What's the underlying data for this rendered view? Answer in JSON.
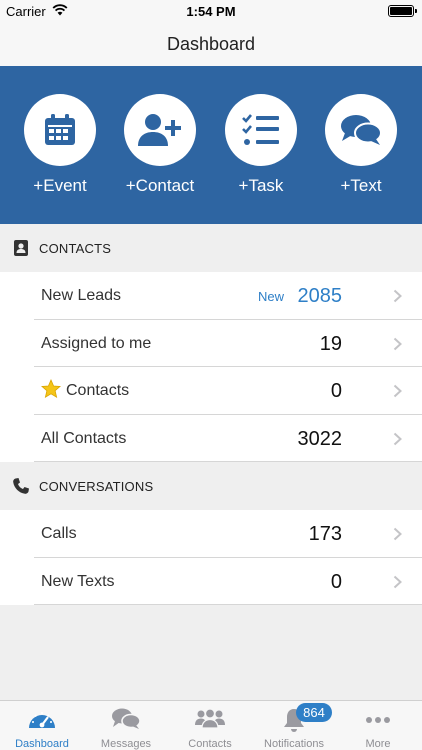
{
  "status_bar": {
    "carrier": "Carrier",
    "time": "1:54 PM"
  },
  "nav": {
    "title": "Dashboard"
  },
  "quick_actions": [
    {
      "label": "+Event",
      "icon": "calendar-icon"
    },
    {
      "label": "+Contact",
      "icon": "add-person-icon"
    },
    {
      "label": "+Task",
      "icon": "checklist-icon"
    },
    {
      "label": "+Text",
      "icon": "chat-bubbles-icon"
    }
  ],
  "contacts_section": {
    "title": "CONTACTS",
    "rows": [
      {
        "label": "New Leads",
        "badge": "New",
        "value": "2085"
      },
      {
        "label": "Assigned to me",
        "value": "19"
      },
      {
        "label": "Contacts",
        "value": "0",
        "icon": "star-icon"
      },
      {
        "label": "All Contacts",
        "value": "3022"
      }
    ]
  },
  "conversations_section": {
    "title": "CONVERSATIONS",
    "rows": [
      {
        "label": "Calls",
        "value": "173"
      },
      {
        "label": "New Texts",
        "value": "0"
      }
    ]
  },
  "tab_bar": {
    "tabs": [
      {
        "label": "Dashboard",
        "icon": "gauge-icon"
      },
      {
        "label": "Messages",
        "icon": "chat-bubbles-icon"
      },
      {
        "label": "Contacts",
        "icon": "group-icon"
      },
      {
        "label": "Notifications",
        "icon": "bell-icon",
        "badge": "864"
      },
      {
        "label": "More",
        "icon": "more-dots-icon"
      }
    ]
  },
  "colors": {
    "accent": "#2e65a2",
    "link": "#2e7fc7",
    "star": "#f5c518"
  }
}
